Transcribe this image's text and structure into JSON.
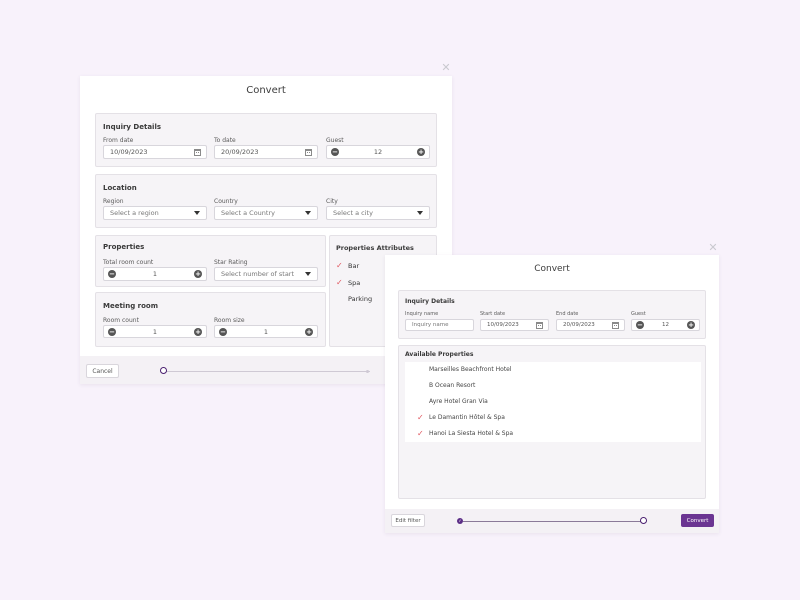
{
  "dialog1": {
    "title": "Convert",
    "close_icon": "close-icon",
    "inquiry": {
      "title": "Inquiry Details",
      "from_label": "From date",
      "from_value": "10/09/2023",
      "to_label": "To date",
      "to_value": "20/09/2023",
      "guest_label": "Guest",
      "guest_value": "12"
    },
    "location": {
      "title": "Location",
      "region_label": "Region",
      "region_placeholder": "Select a region",
      "country_label": "Country",
      "country_placeholder": "Select a Country",
      "city_label": "City",
      "city_placeholder": "Select a city"
    },
    "properties": {
      "title": "Properties",
      "room_count_label": "Total room count",
      "room_count_value": "1",
      "star_label": "Star Rating",
      "star_placeholder": "Select number of start"
    },
    "meeting": {
      "title": "Meeting room",
      "count_label": "Room count",
      "count_value": "1",
      "size_label": "Room size",
      "size_value": "1"
    },
    "attributes": {
      "title": "Properties Attributes",
      "items": [
        {
          "label": "Bar",
          "checked": true
        },
        {
          "label": "Spa",
          "checked": true
        },
        {
          "label": "Parking",
          "checked": false
        }
      ]
    },
    "footer": {
      "cancel_label": "Cancel"
    }
  },
  "dialog2": {
    "title": "Convert",
    "close_icon": "close-icon",
    "inquiry": {
      "title": "Inquiry Details",
      "name_label": "Inquiry name",
      "name_placeholder": "Inquiry name",
      "start_label": "Start date",
      "start_value": "10/09/2023",
      "end_label": "End date",
      "end_value": "20/09/2023",
      "guest_label": "Guest",
      "guest_value": "12"
    },
    "available": {
      "title": "Available Properties",
      "items": [
        {
          "label": "Marseilles Beachfront Hotel",
          "checked": false
        },
        {
          "label": "B Ocean Resort",
          "checked": false
        },
        {
          "label": "Ayre Hotel Gran Via",
          "checked": false
        },
        {
          "label": "Le Damantin Hôtel & Spa",
          "checked": true
        },
        {
          "label": "Hanoi La Siesta Hotel & Spa",
          "checked": true
        }
      ]
    },
    "footer": {
      "edit_filter_label": "Edit filter",
      "convert_label": "Convert"
    }
  },
  "colors": {
    "background": "#f8f2fb",
    "accent": "#6b3592",
    "check": "#e0555e"
  }
}
